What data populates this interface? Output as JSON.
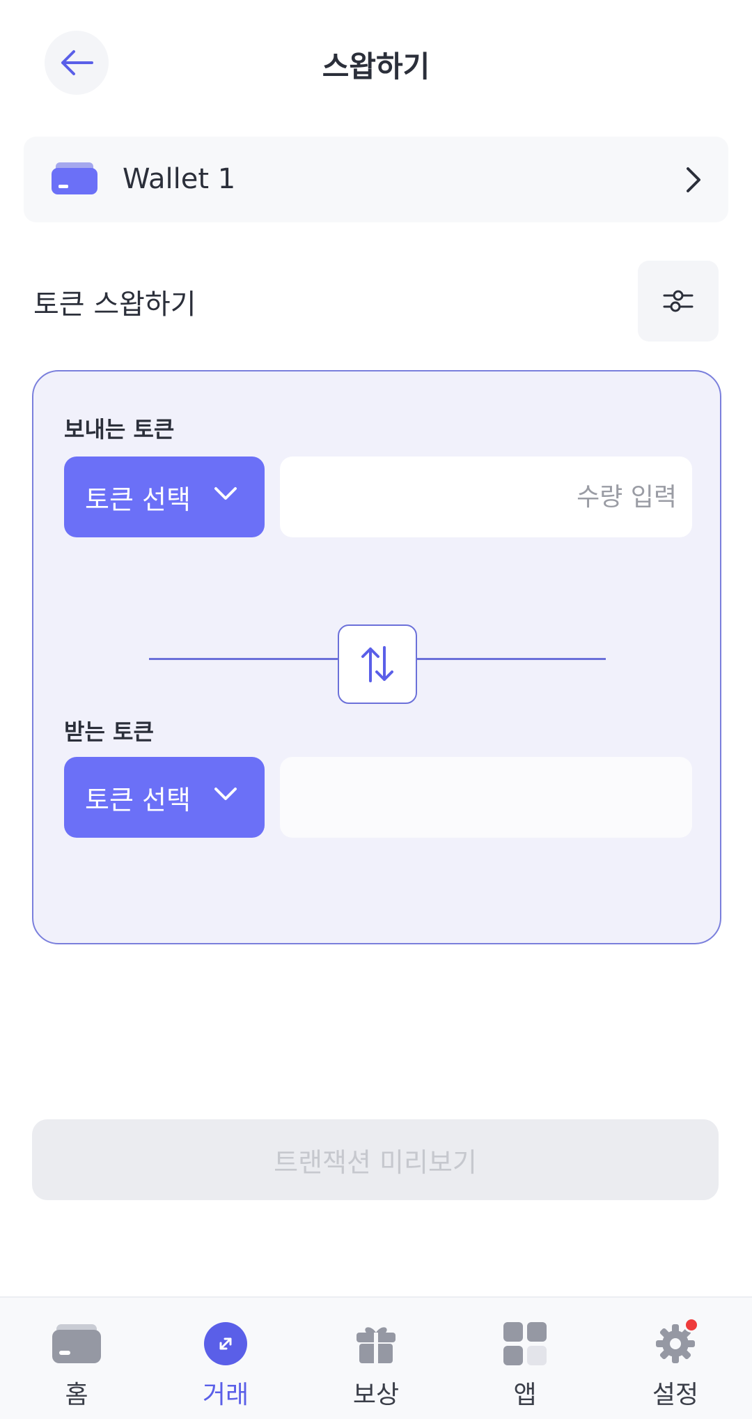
{
  "header": {
    "title": "스왑하기",
    "back_icon": "arrow-left-icon"
  },
  "wallet": {
    "name": "Wallet 1",
    "icon": "wallet-icon",
    "chevron": "chevron-right-icon"
  },
  "section": {
    "title": "토큰 스왑하기",
    "settings_icon": "sliders-icon"
  },
  "swap": {
    "send_label": "보내는 토큰",
    "send_token_button": "토큰 선택",
    "amount_placeholder": "수량 입력",
    "amount_value": "",
    "receive_label": "받는 토큰",
    "receive_token_button": "토큰 선택",
    "receive_amount": "",
    "switch_icon": "swap-vertical-icon"
  },
  "preview_button": "트랜잭션 미리보기",
  "tabs": [
    {
      "label": "홈",
      "icon": "wallet-icon",
      "active": false
    },
    {
      "label": "거래",
      "icon": "trade-icon",
      "active": true
    },
    {
      "label": "보상",
      "icon": "gift-icon",
      "active": false
    },
    {
      "label": "앱",
      "icon": "apps-grid-icon",
      "active": false
    },
    {
      "label": "설정",
      "icon": "gear-icon",
      "active": false,
      "badge": true
    }
  ],
  "colors": {
    "accent": "#6b70f7",
    "card_bg": "#f1f1fb",
    "card_border": "#7a7fdc",
    "badge": "#ee3b3b"
  }
}
